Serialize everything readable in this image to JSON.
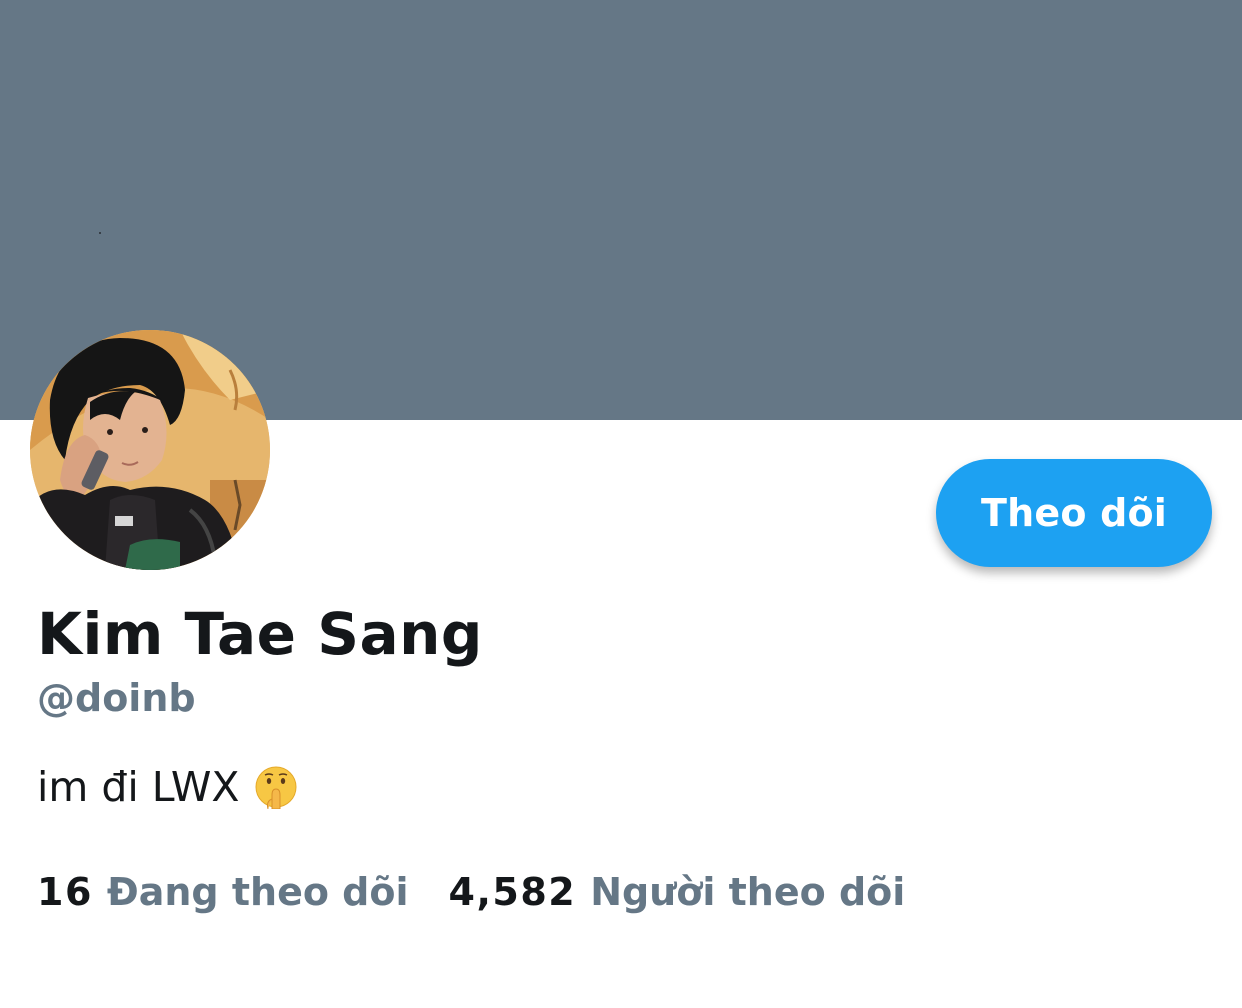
{
  "profile": {
    "display_name": "Kim Tae Sang",
    "handle": "@doinb",
    "bio": "im đi LWX",
    "bio_emoji": "shushing-face-emoji",
    "avatar": "profile-photo"
  },
  "actions": {
    "follow_label": "Theo dõi"
  },
  "stats": {
    "following_count": "16",
    "following_label": "Đang theo dõi",
    "followers_count": "4,582",
    "followers_label": "Người theo dõi"
  },
  "colors": {
    "banner": "#657786",
    "accent": "#1da1f2",
    "primary_text": "#14171a",
    "secondary_text": "#657786"
  }
}
